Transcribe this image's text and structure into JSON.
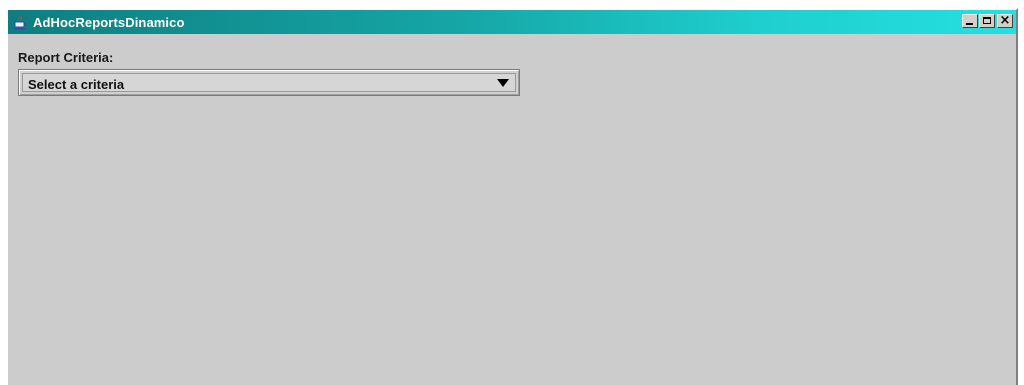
{
  "window": {
    "title": "AdHocReportsDinamico",
    "app_icon": "java-cup-icon",
    "title_gradient_start": "#0e7e80",
    "title_gradient_end": "#25e0e0",
    "background": "#cccccc"
  },
  "controls": {
    "minimize_icon": "minimize-icon",
    "maximize_icon": "maximize-icon",
    "close_icon": "close-icon",
    "close_glyph": "×"
  },
  "form": {
    "criteria_label": "Report Criteria:",
    "criteria_selected": "Select a criteria",
    "dropdown_icon": "chevron-down-icon"
  }
}
